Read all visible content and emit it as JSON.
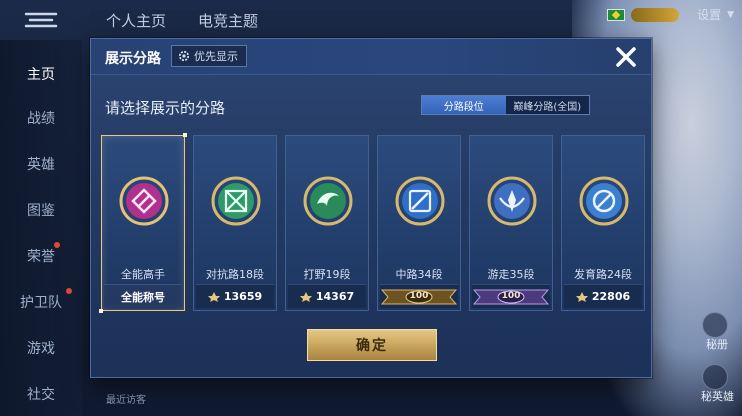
{
  "topnav": {
    "tabs": [
      "个人主页",
      "电竞主题"
    ],
    "settings_label": "设置"
  },
  "sidebar": {
    "items": [
      {
        "label": "主页",
        "active": true
      },
      {
        "label": "战绩"
      },
      {
        "label": "英雄"
      },
      {
        "label": "图鉴"
      },
      {
        "label": "荣誉",
        "badge": true
      },
      {
        "label": "护卫队",
        "badge": true
      },
      {
        "label": "游戏"
      },
      {
        "label": "社交"
      }
    ]
  },
  "right_actions": [
    {
      "icon": "figure-icon",
      "label": "秘册"
    },
    {
      "icon": "hero-icon",
      "label": "秘英雄"
    }
  ],
  "footer": {
    "visitors_label": "最近访客"
  },
  "modal": {
    "title": "展示分路",
    "priority_label": "优先显示",
    "prompt": "请选择展示的分路",
    "toggle": {
      "options": [
        "分路段位",
        "巅峰分路(全国)"
      ],
      "selected_index": 0
    },
    "cards": [
      {
        "name": "全能高手",
        "footer": "全能称号",
        "footer_type": "text",
        "emblem_color": "#b0308e",
        "selected": true
      },
      {
        "name": "对抗路18段",
        "footer": "13659",
        "footer_type": "score",
        "emblem_color": "#2e9a6a"
      },
      {
        "name": "打野19段",
        "footer": "14367",
        "footer_type": "score",
        "emblem_color": "#2b8a5c"
      },
      {
        "name": "中路34段",
        "footer": "100",
        "footer_type": "rank",
        "emblem_color": "#2f6fc8",
        "badge_color": "#c9a35c"
      },
      {
        "name": "游走35段",
        "footer": "100",
        "footer_type": "rank",
        "emblem_color": "#3e6fc0",
        "badge_color": "#8e72c8"
      },
      {
        "name": "发育路24段",
        "footer": "22806",
        "footer_type": "score",
        "emblem_color": "#3b7fd0"
      }
    ],
    "confirm_label": "确定"
  },
  "colors": {
    "accent_gold": "#e6c988",
    "toggle_selected": "#3f72c8",
    "modal_bg": "#233a63"
  }
}
